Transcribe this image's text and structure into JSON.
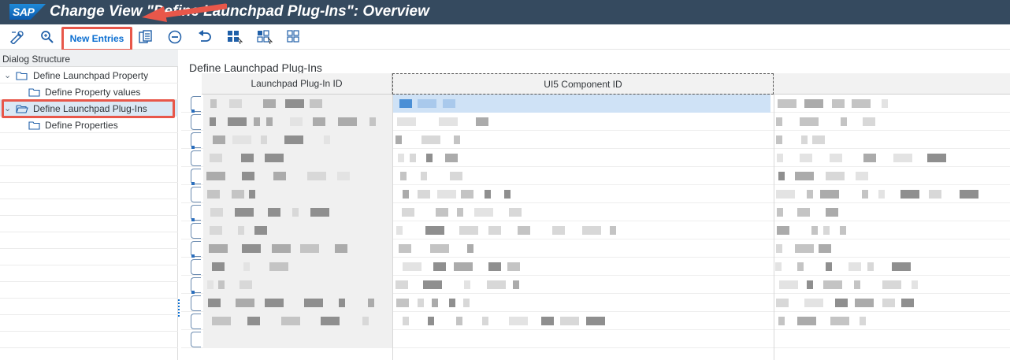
{
  "title_bar": {
    "logo_text": "SAP",
    "title": "Change View \"Define Launchpad Plug-Ins\": Overview"
  },
  "toolbar": {
    "icons": [
      "edit-display-icon",
      "find-icon",
      "copy-as-icon",
      "delete-icon",
      "undo-icon",
      "select-all-icon",
      "select-block-icon",
      "deselect-all-icon"
    ],
    "new_entries_label": "New Entries"
  },
  "dialog_structure": {
    "header": "Dialog Structure",
    "items": [
      {
        "label": "Define Launchpad Property",
        "expanded": true,
        "level": 0
      },
      {
        "label": "Define Property values",
        "level": 1
      },
      {
        "label": "Define Launchpad Plug-Ins",
        "expanded": true,
        "level": 0,
        "selected": true
      },
      {
        "label": "Define Properties",
        "level": 1
      }
    ]
  },
  "main": {
    "section_title": "Define Launchpad Plug-Ins",
    "columns": [
      "Launchpad Plug-In ID",
      "UI5 Component ID",
      ""
    ]
  },
  "colors": {
    "title_bar_bg": "#354a5f",
    "accent": "#0a6ed1",
    "highlight_border": "#e8574a",
    "selected_cell": "#cfe2f6"
  }
}
